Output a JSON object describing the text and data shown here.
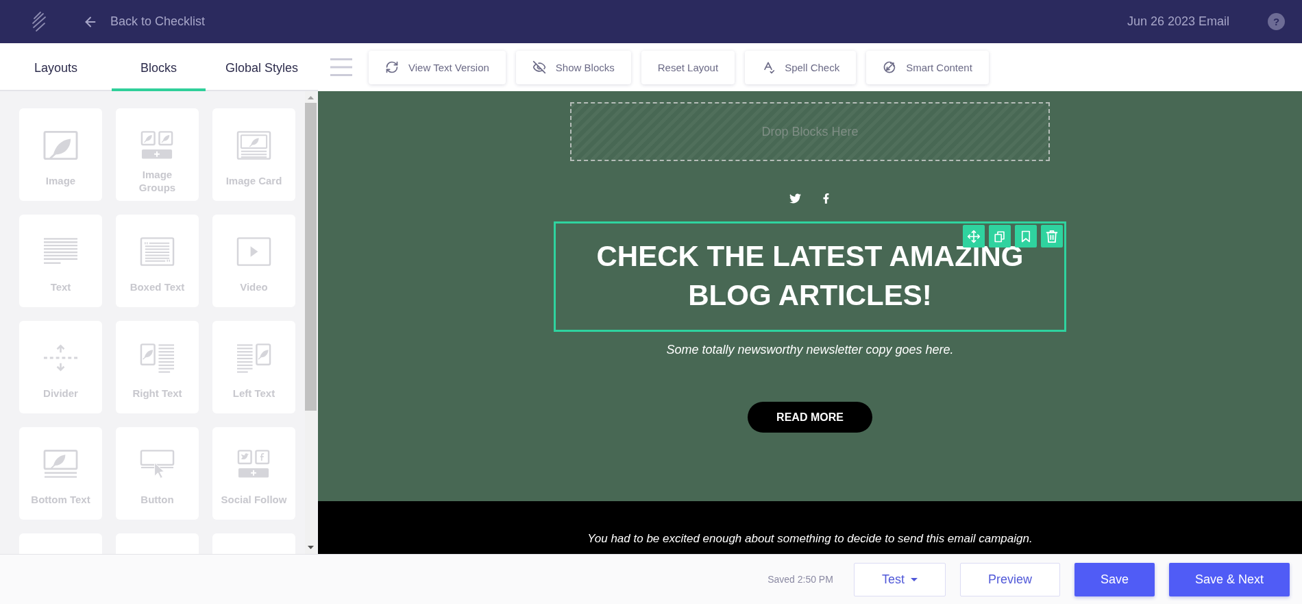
{
  "header": {
    "back_link": "Back to Checklist",
    "email_name": "Jun 26 2023 Email",
    "help": "?"
  },
  "panel_tabs": [
    {
      "label": "Layouts",
      "selected": false
    },
    {
      "label": "Blocks",
      "selected": true
    },
    {
      "label": "Global Styles",
      "selected": false
    }
  ],
  "toolbar": [
    {
      "label": "View Text Version"
    },
    {
      "label": "Show Blocks"
    },
    {
      "label": "Reset Layout"
    },
    {
      "label": "Spell Check"
    },
    {
      "label": "Smart Content"
    }
  ],
  "blocks": [
    {
      "label": "Image"
    },
    {
      "label": "Image Groups"
    },
    {
      "label": "Image Card"
    },
    {
      "label": "Text"
    },
    {
      "label": "Boxed Text"
    },
    {
      "label": "Video"
    },
    {
      "label": "Divider"
    },
    {
      "label": "Right Text"
    },
    {
      "label": "Left Text"
    },
    {
      "label": "Bottom Text"
    },
    {
      "label": "Button"
    },
    {
      "label": "Social Follow"
    }
  ],
  "email": {
    "drop_zone": "Drop Blocks Here",
    "heading": {
      "text": "CHECK THE LATEST AMAZING BLOG ARTICLES!",
      "selected": true
    },
    "intro": "Some totally newsworthy newsletter copy goes here.",
    "cta": "READ MORE",
    "footer_text": "You had to be excited enough about something to decide to send this email campaign."
  },
  "bottom_bar": {
    "status": "Saved 2:50 PM",
    "buttons": [
      {
        "label": "Test",
        "kind": "dropdown"
      },
      {
        "label": "Preview",
        "kind": "outline"
      },
      {
        "label": "Save",
        "kind": "primary"
      },
      {
        "label": "Save & Next",
        "kind": "primary"
      }
    ]
  }
}
